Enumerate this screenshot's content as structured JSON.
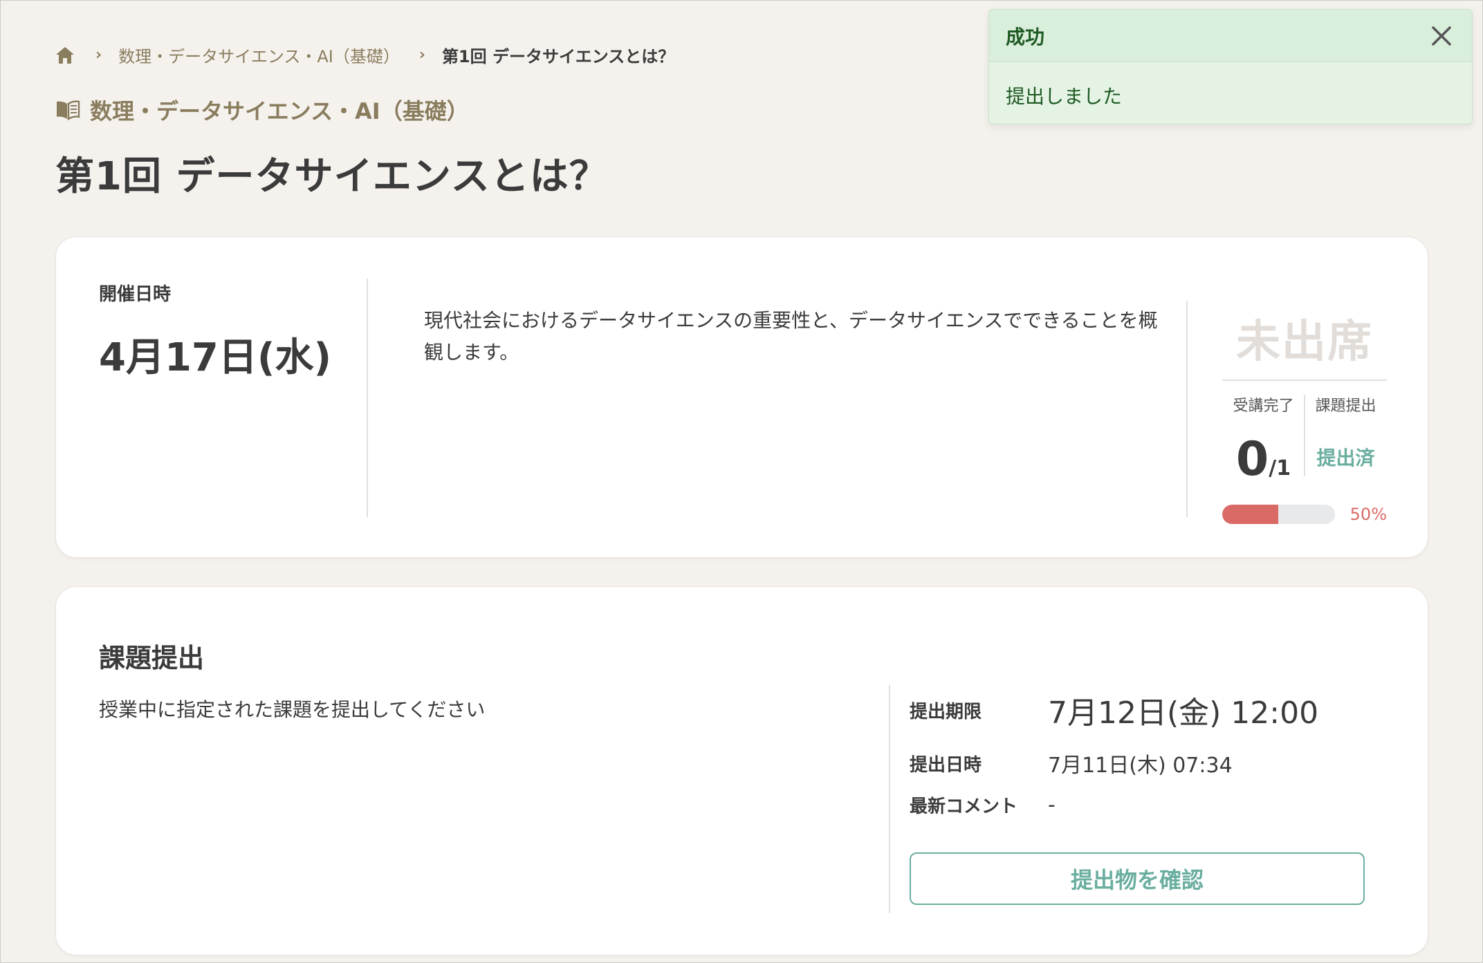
{
  "breadcrumb": {
    "home_icon": "home-icon",
    "course": "数理・データサイエンス・AI（基礎）",
    "current": "第1回 データサイエンスとは？"
  },
  "course_title": "数理・データサイエンス・AI（基礎）",
  "lecture_title": "第1回 データサイエンスとは？",
  "session": {
    "date_label": "開催日時",
    "date_value": "4月17日(水)",
    "description": "現代社会におけるデータサイエンスの重要性と、データサイエンスでできることを概観します。",
    "attendance": "未出席",
    "stats": {
      "completed_label": "受講完了",
      "completed_value": "0",
      "completed_total": "/1",
      "assignment_label": "課題提出",
      "assignment_value": "提出済"
    },
    "progress_percent": 50,
    "progress_text": "50%"
  },
  "assignment": {
    "title": "課題提出",
    "description": "授業中に指定された課題を提出してください",
    "deadline_label": "提出期限",
    "deadline_value": "7月12日(金) 12:00",
    "submitted_label": "提出日時",
    "submitted_value": "7月11日(木) 07:34",
    "comment_label": "最新コメント",
    "comment_value": "-",
    "confirm_button": "提出物を確認"
  },
  "toast": {
    "title": "成功",
    "message": "提出しました"
  },
  "colors": {
    "accent_green": "#6aaea0",
    "progress_red": "#d96a66",
    "brand_olive": "#8a7d5e"
  }
}
